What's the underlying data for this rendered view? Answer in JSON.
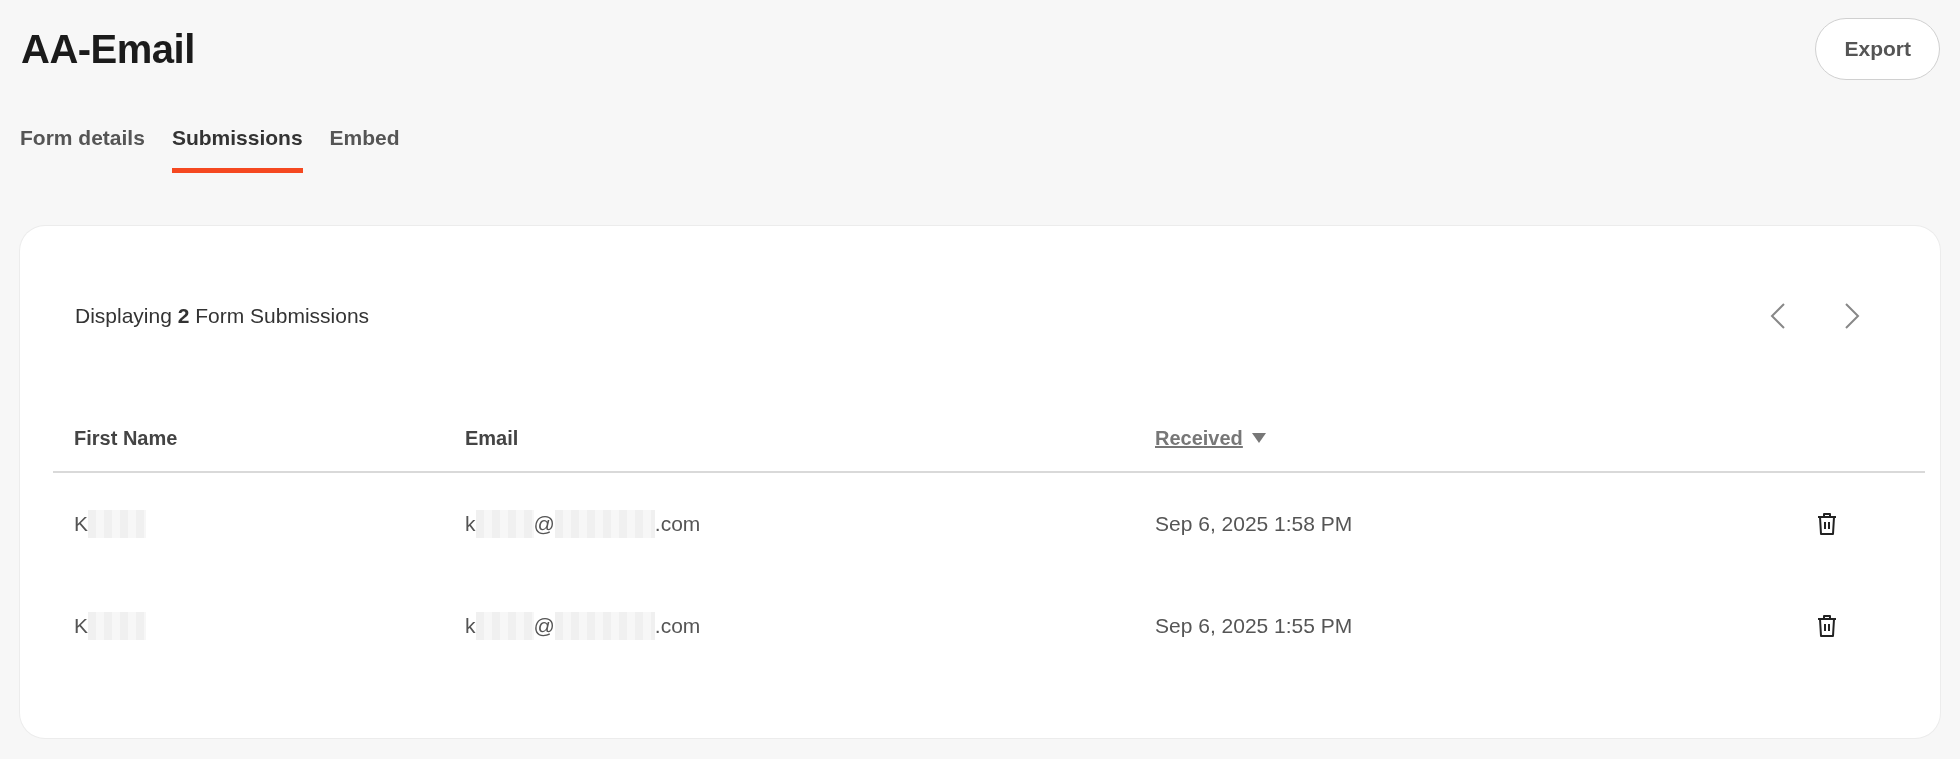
{
  "header": {
    "title": "AA-Email",
    "export_button": "Export"
  },
  "tabs": [
    {
      "label": "Form details",
      "selected": false
    },
    {
      "label": "Submissions",
      "selected": true
    },
    {
      "label": "Embed",
      "selected": false
    }
  ],
  "summary": "Displaying **2** Form Submissions",
  "table": {
    "columns": [
      {
        "label": "First Name",
        "sortable": false
      },
      {
        "label": "Email",
        "sortable": false
      },
      {
        "label": "Received",
        "sortable": true,
        "sorted_descending": true
      }
    ],
    "rows": [
      {
        "first_name": [
          {
            "kind": "text",
            "text": "K"
          },
          {
            "kind": "redacted"
          }
        ],
        "email": [
          {
            "kind": "text",
            "text": "k"
          },
          {
            "kind": "redacted"
          },
          {
            "kind": "text",
            "text": "@"
          },
          {
            "kind": "redacted"
          },
          {
            "kind": "text",
            "text": ".com"
          }
        ],
        "received": "Sep 6, 2025 1:58 PM"
      },
      {
        "first_name": [
          {
            "kind": "text",
            "text": "K"
          },
          {
            "kind": "redacted"
          }
        ],
        "email": [
          {
            "kind": "text",
            "text": "k"
          },
          {
            "kind": "redacted"
          },
          {
            "kind": "text",
            "text": "@"
          },
          {
            "kind": "redacted"
          },
          {
            "kind": "text",
            "text": ".com"
          }
        ],
        "received": "Sep 6, 2025 1:55 PM"
      }
    ]
  }
}
